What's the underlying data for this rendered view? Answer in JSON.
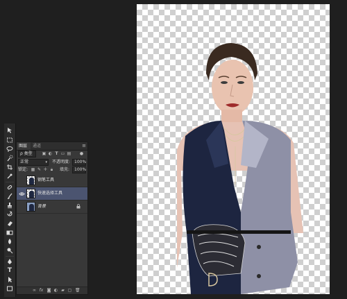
{
  "layers_panel": {
    "tabs": [
      "图层",
      "通道"
    ],
    "filter_label": "ρ 类型",
    "blend_mode": "正常",
    "opacity_label": "不透明度:",
    "opacity_value": "100%",
    "lock_label": "锁定:",
    "fill_label": "填充:",
    "fill_value": "100%",
    "layers": [
      {
        "name": "钢笔工具",
        "selected": false,
        "visible": false
      },
      {
        "name": "快速选择工具",
        "selected": true,
        "visible": true
      },
      {
        "name": "背景",
        "selected": false,
        "visible": false,
        "locked": true
      }
    ]
  },
  "tools": {
    "items": [
      "move-tool-icon",
      "marquee-tool-icon",
      "lasso-tool-icon",
      "quick-selection-tool-icon",
      "crop-tool-icon",
      "eyedropper-tool-icon",
      "healing-brush-icon",
      "brush-tool-icon",
      "clone-stamp-icon",
      "history-brush-icon",
      "eraser-tool-icon",
      "gradient-tool-icon",
      "blur-tool-icon",
      "dodge-tool-icon",
      "pen-tool-icon",
      "type-tool-icon",
      "path-selection-icon",
      "shape-tool-icon",
      "hand-tool-icon",
      "zoom-tool-icon"
    ]
  },
  "colors": {
    "app_bg": "#1f1f1f",
    "panel_bg": "#383838",
    "selected_layer": "#4b5470"
  }
}
